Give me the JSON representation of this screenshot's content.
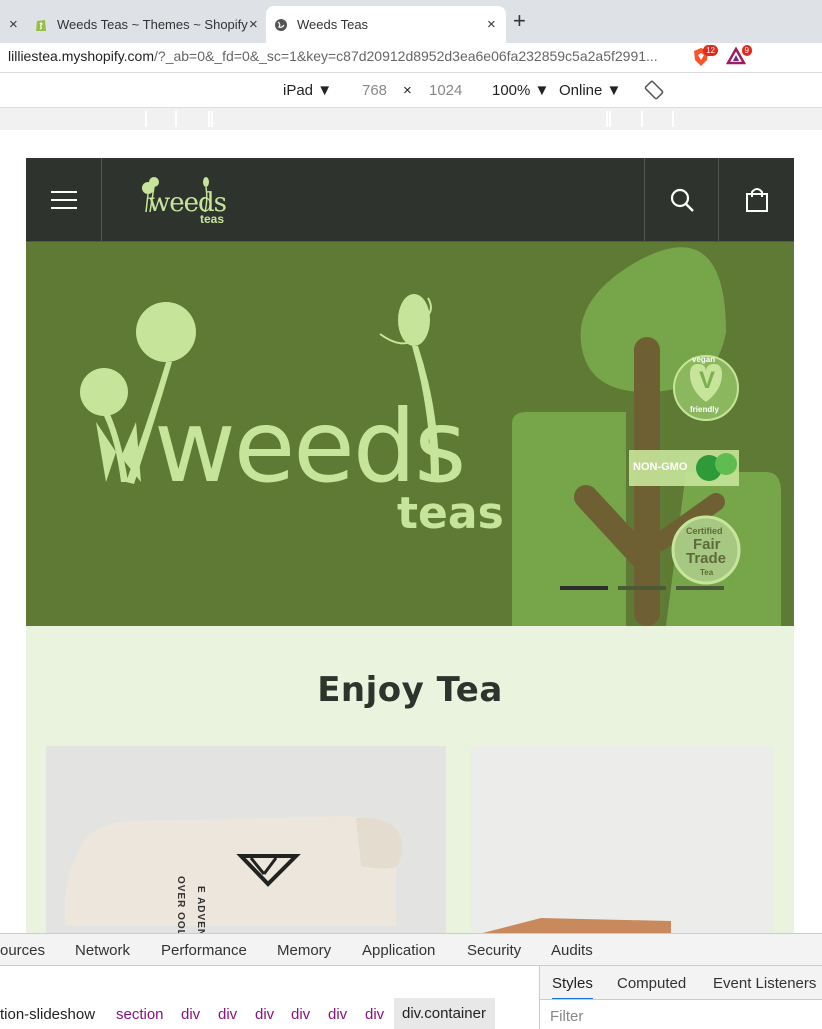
{
  "browser": {
    "tabs": [
      {
        "title": "Weeds Teas ~ Themes ~ Shopify",
        "active": false
      },
      {
        "title": "Weeds Teas",
        "active": true
      }
    ],
    "new_tab_label": "+",
    "close_label": "×",
    "url_main": "lilliestea.myshopify.com",
    "url_rest": "/?_ab=0&_fd=0&_sc=1&key=c87d20912d8952d3ea6e06fa232859c5a2a5f2991...",
    "ext_brave_count": "12",
    "ext_alert_count": "9"
  },
  "device_toolbar": {
    "device": "iPad ▼",
    "width": "768",
    "times": "×",
    "height": "1024",
    "zoom": "100% ▼",
    "network": "Online ▼"
  },
  "site": {
    "logo_word": "weeds",
    "logo_sub": "teas",
    "hero_word": "weeds",
    "hero_sub": "teas",
    "badges": {
      "vegan_top": "vegan",
      "vegan_letter": "V",
      "vegan_bottom": "friendly",
      "nongmo": "NON-GMO",
      "fair_1": "Certified",
      "fair_2": "Fair",
      "fair_3": "Trade",
      "fair_4": "Tea"
    },
    "slides": [
      {
        "active": true
      },
      {
        "active": false
      },
      {
        "active": false
      }
    ],
    "section_title": "Enjoy Tea",
    "bag_text": "OVER OOLONG",
    "bag_text2": "E ADVENTURE"
  },
  "devtools": {
    "tabs": [
      "ources",
      "Network",
      "Performance",
      "Memory",
      "Application",
      "Security",
      "Audits"
    ],
    "breadcrumbs": [
      "tion-slideshow",
      "section",
      "div",
      "div",
      "div",
      "div",
      "div",
      "div",
      "div.container"
    ],
    "side_tabs": [
      "Styles",
      "Computed",
      "Event Listeners"
    ],
    "filter_placeholder": "Filter"
  },
  "colors": {
    "header_bg": "#2f332e",
    "hero_bg": "#5e7a34",
    "hero_text": "#c7e59a",
    "section_bg": "#eaf3dd",
    "leaf_green": "#76a54a",
    "trunk": "#6e6033"
  }
}
